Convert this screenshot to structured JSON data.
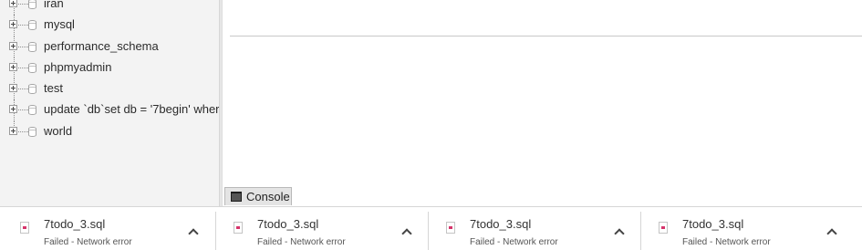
{
  "sidebar": {
    "databases": [
      {
        "name": "iran"
      },
      {
        "name": "mysql"
      },
      {
        "name": "performance_schema"
      },
      {
        "name": "phpmyadmin"
      },
      {
        "name": "test"
      },
      {
        "name": "update `db`set db = '7begin' wher"
      },
      {
        "name": "world"
      }
    ]
  },
  "console": {
    "label": "Console"
  },
  "downloads": [
    {
      "filename": "7todo_3.sql",
      "status": "Failed - Network error"
    },
    {
      "filename": "7todo_3.sql",
      "status": "Failed - Network error"
    },
    {
      "filename": "7todo_3.sql",
      "status": "Failed - Network error"
    },
    {
      "filename": "7todo_3.sql",
      "status": "Failed - Network error"
    }
  ],
  "colors": {
    "file_icon_accent": "#d6346b",
    "sidebar_bg": "#f3f3f3"
  },
  "icons": {
    "expander": "plus-box-icon",
    "database": "database-icon",
    "console": "terminal-icon",
    "file": "file-icon",
    "chevron": "chevron-up-icon"
  }
}
